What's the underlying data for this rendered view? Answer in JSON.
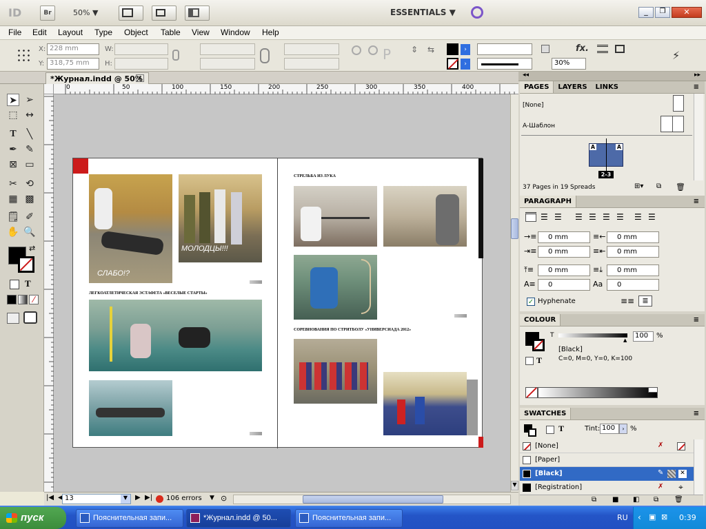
{
  "appbar": {
    "logo": "ID",
    "bridge": "Br",
    "zoom": "50%",
    "workspace": "ESSENTIALS"
  },
  "menu": [
    "File",
    "Edit",
    "Layout",
    "Type",
    "Object",
    "Table",
    "View",
    "Window",
    "Help"
  ],
  "control": {
    "x_label": "X:",
    "x_value": "228 mm",
    "y_label": "Y:",
    "y_value": "318,75 mm",
    "w_label": "W:",
    "h_label": "H:",
    "scale": "30%"
  },
  "document_tab": {
    "title": "*Журнал.indd @ 50%"
  },
  "ruler_labels": [
    "0",
    "50",
    "100",
    "150",
    "200",
    "250",
    "300",
    "350",
    "400"
  ],
  "spread": {
    "captions": {
      "relay": "ЛЕГКОАТЛЕТИЧЕСКАЯ ЭСТАФЕТА «ВЕСЕЛЫЕ СТАРТЫ»",
      "archery": "СТРЕЛЬБА ИЗ ЛУКА",
      "streetball": "СОРЕВНОВАНИЯ ПО СТРИТБОЛУ «УНИВЕРСИАДА 2012»"
    },
    "photo_text": {
      "weak": "СЛАБО!?",
      "well_done": "МОЛОДЦЫ!!!"
    }
  },
  "status": {
    "page": "13",
    "errors": "106 errors"
  },
  "pages_panel": {
    "tabs": [
      "PAGES",
      "LAYERS",
      "LINKS"
    ],
    "none": "[None]",
    "master": "A-Шаблон",
    "badge_a": "A",
    "spread_label": "2-3",
    "summary": "37 Pages in 19 Spreads"
  },
  "paragraph_panel": {
    "title": "PARAGRAPH",
    "fields": [
      "0 mm",
      "0 mm",
      "0 mm",
      "0 mm",
      "0 mm",
      "0 mm",
      "0",
      "0"
    ],
    "hyphenate": "Hyphenate"
  },
  "colour_panel": {
    "title": "COLOUR",
    "tint_label": "T",
    "value": "100",
    "pct": "%",
    "swatch": "[Black]",
    "cmyk": "C=0, M=0, Y=0, K=100"
  },
  "swatches_panel": {
    "title": "SWATCHES",
    "tint_label": "Tint:",
    "tint": "100",
    "pct": "%",
    "items": [
      "[None]",
      "[Paper]",
      "[Black]",
      "[Registration]"
    ]
  },
  "taskbar": {
    "start": "пуск",
    "tasks": [
      "Пояснительная запи...",
      "*Журнал.indd @ 50...",
      "Пояснительная запи..."
    ],
    "lang": "RU",
    "clock": "0:39"
  },
  "colors": {
    "accent": "#cc1b1b",
    "selected_swatch": "#316ac5",
    "taskbar": "#2150c2"
  }
}
